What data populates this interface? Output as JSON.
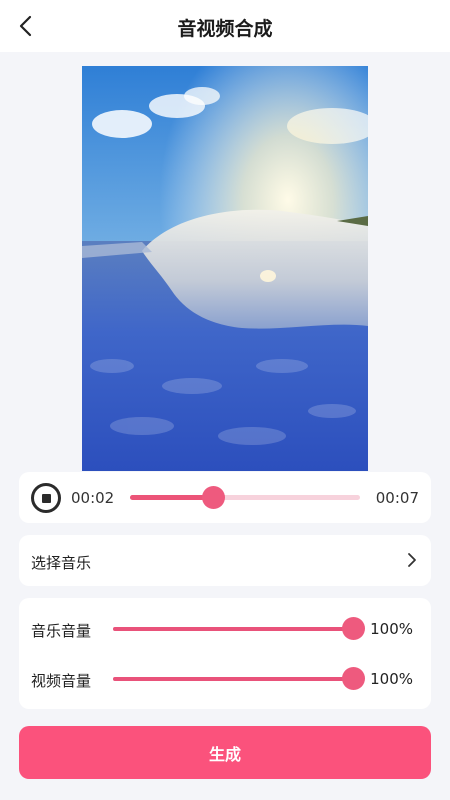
{
  "header": {
    "title": "音视频合成",
    "back_icon": "chevron-left-icon"
  },
  "player": {
    "current_time": "00:02",
    "total_time": "00:07",
    "progress": 0.36,
    "stop_icon": "stop-icon"
  },
  "music": {
    "label": "选择音乐",
    "arrow_icon": "chevron-right-icon"
  },
  "volume": {
    "music_label": "音乐音量",
    "music_value": "100%",
    "music_level": 1.0,
    "video_label": "视频音量",
    "video_value": "100%",
    "video_level": 1.0
  },
  "actions": {
    "generate_label": "生成"
  },
  "colors": {
    "accent": "#ee5a7e",
    "track": "#f7d2dc",
    "button": "#fb527c",
    "background": "#f4f5f9"
  }
}
